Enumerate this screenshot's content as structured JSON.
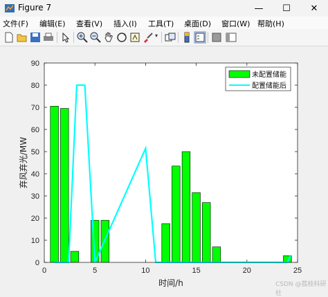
{
  "window": {
    "title": "Figure 7",
    "min_label": "—",
    "max_label": "☐",
    "close_label": "✕"
  },
  "menu": [
    "文件(F)",
    "编辑(E)",
    "查看(V)",
    "插入(I)",
    "工具(T)",
    "桌面(D)",
    "窗口(W)",
    "帮助(H)"
  ],
  "toolbar_icons": [
    "new-figure-icon",
    "open-file-icon",
    "save-icon",
    "print-icon",
    "edit-plot-icon",
    "zoom-in-icon",
    "zoom-out-icon",
    "pan-icon",
    "rotate-3d-icon",
    "data-cursor-icon",
    "brush-icon",
    "link-plot-icon",
    "colorbar-icon",
    "legend-icon",
    "hide-plot-tools-icon",
    "show-plot-tools-icon"
  ],
  "watermark": "CSDN @荔枝科研社",
  "colors": {
    "bar": "#00ff00",
    "line": "#00ffff",
    "axes_bg": "#ffffff"
  },
  "chart_data": {
    "type": "bar",
    "title": "",
    "xlabel": "时间/h",
    "ylabel": "弃风弃光/MW",
    "xlim": [
      0,
      25
    ],
    "ylim": [
      0,
      90
    ],
    "xticks": [
      0,
      5,
      10,
      15,
      20,
      25
    ],
    "yticks": [
      0,
      10,
      20,
      30,
      40,
      50,
      60,
      70,
      80,
      90
    ],
    "legend_position": "top-right",
    "categories": [
      1,
      2,
      3,
      4,
      5,
      6,
      7,
      8,
      9,
      10,
      11,
      12,
      13,
      14,
      15,
      16,
      17,
      18,
      19,
      20,
      21,
      22,
      23,
      24
    ],
    "series": [
      {
        "name": "未配置储能",
        "type": "bar",
        "values": [
          70.5,
          69.5,
          5,
          0,
          19,
          19,
          0,
          0,
          0,
          0,
          0,
          17.5,
          43.5,
          50,
          31.5,
          27,
          7,
          0,
          0,
          0,
          0,
          0,
          0,
          3
        ]
      },
      {
        "name": "配置储能后",
        "type": "line",
        "points": [
          [
            1,
            0
          ],
          [
            2,
            0
          ],
          [
            2.4,
            0
          ],
          [
            3.2,
            80
          ],
          [
            4,
            80
          ],
          [
            4.5,
            40
          ],
          [
            5,
            0
          ],
          [
            10,
            51.5
          ],
          [
            11,
            0
          ],
          [
            24,
            0
          ],
          [
            24.3,
            3
          ]
        ]
      }
    ]
  }
}
